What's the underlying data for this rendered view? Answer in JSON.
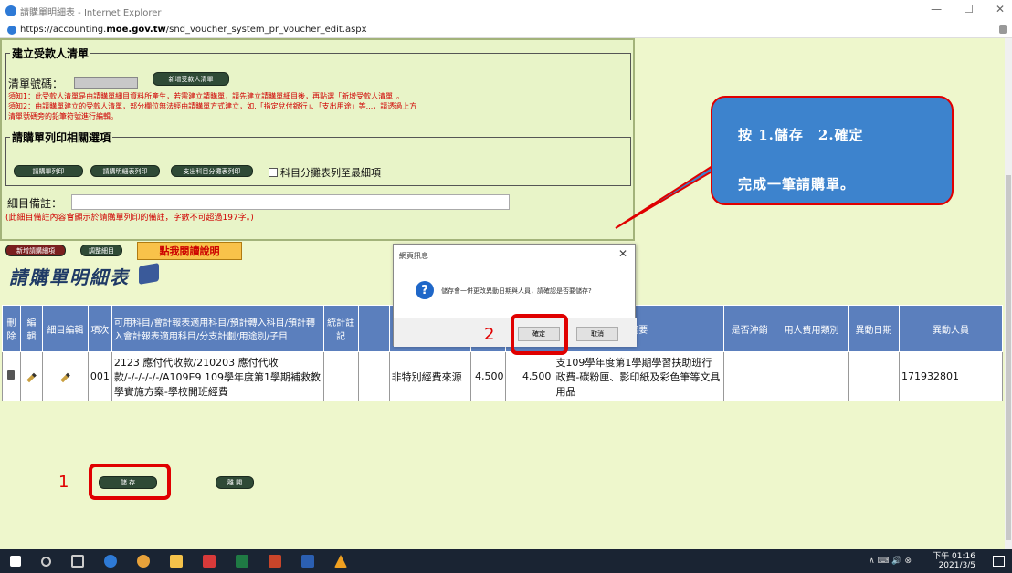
{
  "window": {
    "title": "請購單明細表 - Internet Explorer",
    "minimize": "—",
    "maximize": "☐",
    "close": "✕"
  },
  "address": {
    "prefix": "https://accounting.",
    "domain": "moe.gov.tw",
    "path": "/snd_voucher_system_pr_voucher_edit.aspx"
  },
  "payee": {
    "legend": "建立受款人清單",
    "list_no_label": "清單號碼：",
    "new_btn": "新增受款人清單",
    "note1": "須知1：此受款人清單是由請購單細目資料所產生，若需建立請購單，請先建立請購單細目後，再點選「新增受款人清單」。",
    "note2a": "須知2：由請購單建立的受款人清單，部分欄位無法經由請購單方式建立，如.「指定兌付銀行」、「支出用途」等...，請透過上方",
    "note2b": "清單號碼旁的鉛筆符號進行編輯。"
  },
  "print": {
    "legend": "請購單列印相關選項",
    "btn1": "請購單列印",
    "btn2": "請購明細表列印",
    "btn3": "支出科目分攤表列印",
    "checkbox": "科目分攤表列至最細項"
  },
  "remark": {
    "label": "細目備註：",
    "hint": "(此細目備註內容會顯示於請購單列印的備註，字數不可超過197字。)"
  },
  "actions": {
    "add_item": "新增請購細項",
    "adjust": "調整細目",
    "howto": "點我閱讀說明"
  },
  "detail_title": "請購單明細表",
  "table": {
    "headers": [
      "刪除",
      "編輯",
      "細目編輯",
      "項次",
      "可用科目/會計報表適用科目/預計轉入科目/預計轉入會計報表適用科目/分支計劃/用途別/子目",
      "統計註記",
      "",
      "",
      "",
      "",
      "摘要",
      "是否沖銷",
      "用人費用類別",
      "異動日期",
      "異動人員"
    ],
    "row": {
      "item": "001",
      "subject": "2123 應付代收款/210203 應付代收款/-/-/-/-/-/A109E9 109學年度第1學期補救教學實施方案-學校開班經費",
      "source": "非特別經費來源",
      "amount1": "4,500",
      "amount2": "4,500",
      "summary": "支109學年度第1學期學習扶助班行政費-碳粉匣、影印紙及彩色筆等文具用品",
      "modifier": "171932801"
    }
  },
  "bottom": {
    "save": "儲 存",
    "leave": "離 開"
  },
  "dialog": {
    "title": "網頁訊息",
    "close": "✕",
    "icon": "?",
    "message": "儲存會一併更改異動日期與人員，請確認是否要儲存?",
    "ok": "確定",
    "cancel": "取消"
  },
  "annotations": {
    "num1": "1",
    "num2": "2",
    "callout_line1": "按 1.儲存　2.確定",
    "callout_line2": "完成一筆請購單。"
  },
  "taskbar": {
    "time": "下午 01:16",
    "date": "2021/3/5",
    "tray": "∧ ⌨ 🔊 ⊗"
  },
  "colors": {
    "header": "#5b7fbd",
    "callout": "#3d83cd",
    "highlight": "#e00000"
  }
}
